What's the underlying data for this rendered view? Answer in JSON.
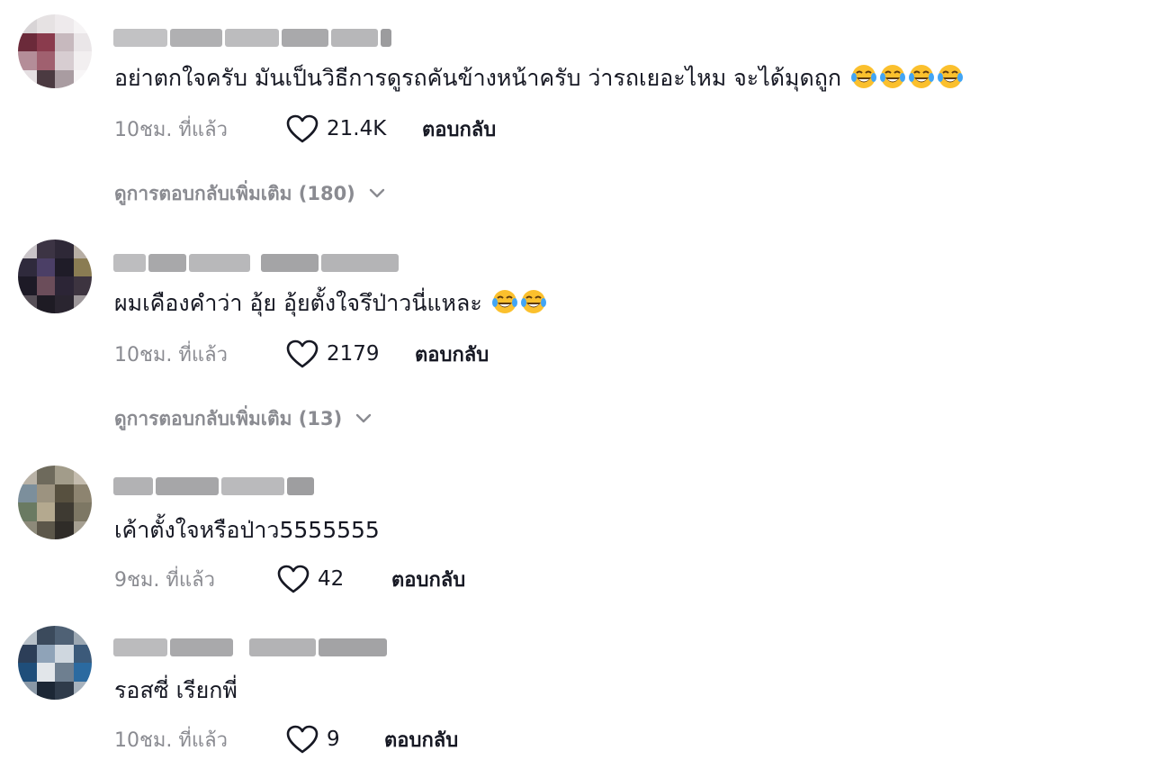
{
  "comments": [
    {
      "text": "อย่าตกใจครับ มันเป็นวิธีการดูรถคันข้างหน้าครับ ว่ารถเยอะไหม จะได้มุดถูก",
      "emoji_icons": [
        "face-with-tears-of-joy-icon",
        "face-with-tears-of-joy-icon",
        "face-with-tears-of-joy-icon",
        "face-with-tears-of-joy-icon"
      ],
      "time": "10ชม. ที่แล้ว",
      "likes": "21.4K",
      "reply_label": "ตอบกลับ",
      "view_replies": "ดูการตอบกลับเพิ่มเติม (180)"
    },
    {
      "text": "ผมเคืองคำว่า อุ้ย อุ้ยตั้งใจรึป่าวนี่แหละ",
      "emoji_icons": [
        "face-with-tears-of-joy-icon",
        "face-with-tears-of-joy-icon"
      ],
      "time": "10ชม. ที่แล้ว",
      "likes": "2179",
      "reply_label": "ตอบกลับ",
      "view_replies": "ดูการตอบกลับเพิ่มเติม (13)"
    },
    {
      "text": "เค้าตั้งใจหรือป่าว5555555",
      "emoji_icons": [],
      "time": "9ชม. ที่แล้ว",
      "likes": "42",
      "reply_label": "ตอบกลับ"
    },
    {
      "text": "รอสซี่ เรียกพี่",
      "emoji_icons": [],
      "time": "10ชม. ที่แล้ว",
      "likes": "9",
      "reply_label": "ตอบกลับ"
    }
  ],
  "icons": {
    "like": "heart-outline-icon",
    "expand": "chevron-down-icon"
  },
  "colors": {
    "primary_text": "#161823",
    "secondary_text": "#8a8b91",
    "background": "#ffffff"
  }
}
